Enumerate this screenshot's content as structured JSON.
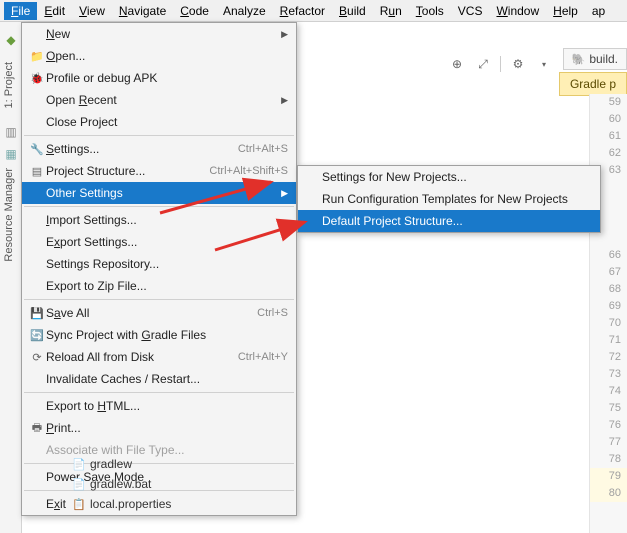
{
  "menubar": {
    "items": [
      "File",
      "Edit",
      "View",
      "Navigate",
      "Code",
      "Analyze",
      "Refactor",
      "Build",
      "Run",
      "Tools",
      "VCS",
      "Window",
      "Help",
      "ap"
    ],
    "underlines": [
      "F",
      "E",
      "V",
      "N",
      "C",
      "",
      "R",
      "B",
      "u",
      "T",
      "",
      "W",
      "H",
      ""
    ]
  },
  "sidebar": {
    "project": "1: Project",
    "resmgr": "Resource Manager"
  },
  "filetab": {
    "label": "build."
  },
  "hint": {
    "text": "Gradle p"
  },
  "toolbar": {},
  "dropdown": {
    "items": [
      {
        "icon": "",
        "label": "New",
        "shortcut": "",
        "sub": true
      },
      {
        "icon": "folder",
        "label": "Open...",
        "shortcut": ""
      },
      {
        "icon": "bug",
        "label": "Profile or debug APK",
        "shortcut": ""
      },
      {
        "icon": "",
        "label": "Open Recent",
        "shortcut": "",
        "sub": true
      },
      {
        "icon": "",
        "label": "Close Project",
        "shortcut": ""
      },
      {
        "sep": true
      },
      {
        "icon": "wrench",
        "label": "Settings...",
        "shortcut": "Ctrl+Alt+S"
      },
      {
        "icon": "struct",
        "label": "Project Structure...",
        "shortcut": "Ctrl+Alt+Shift+S"
      },
      {
        "icon": "",
        "label": "Other Settings",
        "shortcut": "",
        "sub": true,
        "hl": true
      },
      {
        "sep": true
      },
      {
        "icon": "",
        "label": "Import Settings...",
        "shortcut": ""
      },
      {
        "icon": "",
        "label": "Export Settings...",
        "shortcut": ""
      },
      {
        "icon": "",
        "label": "Settings Repository...",
        "shortcut": ""
      },
      {
        "icon": "",
        "label": "Export to Zip File...",
        "shortcut": ""
      },
      {
        "sep": true
      },
      {
        "icon": "save",
        "label": "Save All",
        "shortcut": "Ctrl+S"
      },
      {
        "icon": "sync",
        "label": "Sync Project with Gradle Files",
        "shortcut": ""
      },
      {
        "icon": "reload",
        "label": "Reload All from Disk",
        "shortcut": "Ctrl+Alt+Y"
      },
      {
        "icon": "",
        "label": "Invalidate Caches / Restart...",
        "shortcut": ""
      },
      {
        "sep": true
      },
      {
        "icon": "",
        "label": "Export to HTML...",
        "shortcut": ""
      },
      {
        "icon": "print",
        "label": "Print...",
        "shortcut": ""
      },
      {
        "icon": "",
        "label": "Associate with File Type...",
        "shortcut": "",
        "disabled": true
      },
      {
        "sep": true
      },
      {
        "icon": "",
        "label": "Power Save Mode",
        "shortcut": ""
      },
      {
        "sep": true
      },
      {
        "icon": "",
        "label": "Exit",
        "shortcut": ""
      }
    ]
  },
  "submenu": {
    "items": [
      {
        "label": "Settings for New Projects..."
      },
      {
        "label": "Run Configuration Templates for New Projects"
      },
      {
        "label": "Default Project Structure...",
        "hl": true
      }
    ]
  },
  "tree": {
    "rows": [
      {
        "icon": "file",
        "label": "gradlew"
      },
      {
        "icon": "file",
        "label": "gradlew.bat"
      },
      {
        "icon": "prop",
        "label": "local.properties"
      }
    ]
  },
  "gutter": {
    "start": 59,
    "lines": [
      59,
      60,
      61,
      62,
      63,
      "",
      "",
      "",
      "",
      66,
      67,
      68,
      69,
      70,
      71,
      72,
      73,
      74,
      75,
      76,
      77,
      78,
      79,
      80
    ],
    "hl": [
      79,
      80
    ]
  },
  "underlineMap": {
    "New": "N",
    "Open...": "O",
    "Open Recent": "R",
    "Close Project": "J",
    "Settings...": "S",
    "Project Structure...": "",
    "Other Settings": "",
    "Import Settings...": "I",
    "Export Settings...": "x",
    "Export to Zip File...": "",
    "Save All": "a",
    "Sync Project with Gradle Files": "G",
    "Reload All from Disk": "",
    "Export to HTML...": "H",
    "Print...": "P",
    "Power Save Mode": "",
    "Exit": "x"
  }
}
